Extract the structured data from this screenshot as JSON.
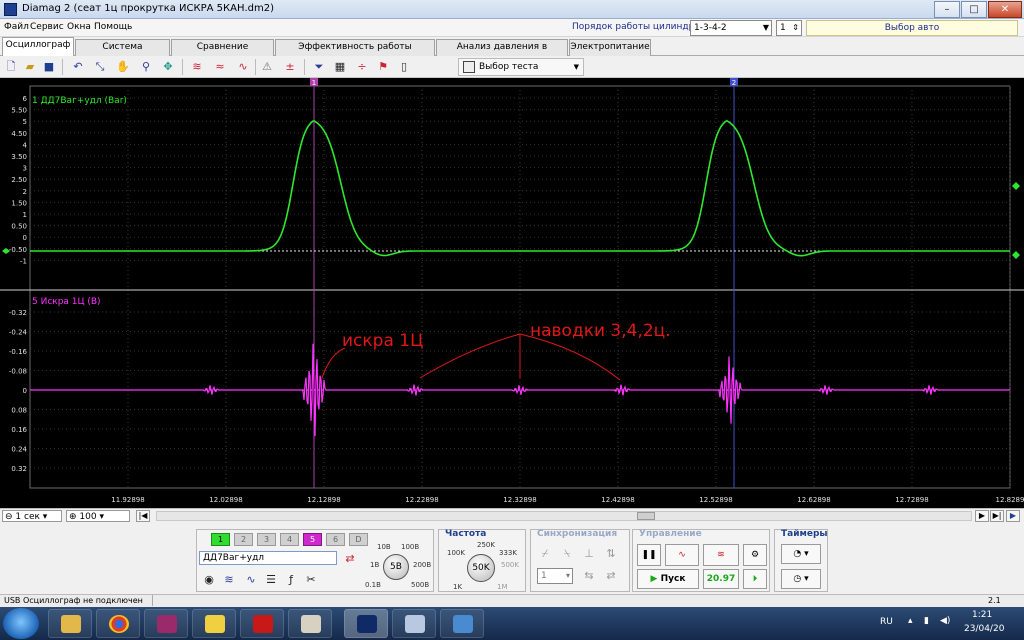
{
  "window": {
    "title": "Diamag 2 (сеат 1ц прокрутка ИСКРА 5КАН.dm2)",
    "minimize": "–",
    "maximize": "□",
    "close": "✕"
  },
  "menu": {
    "items": [
      "Файл",
      "Сервис",
      "Окна",
      "Помощь"
    ],
    "firing_order_label": "Порядок работы цилиндров",
    "firing_order_value": "1-3-4-2",
    "cylinder_value": "1",
    "auto_select": "Выбор авто"
  },
  "tabs": [
    "Осциллограф",
    "Система зажигания",
    "Сравнение цилиндров",
    "Эффективность работы цилиндров",
    "Анализ давления в цилиндре",
    "Электропитание"
  ],
  "toolbar": {
    "icons": [
      "new-file-icon",
      "open-folder-icon",
      "save-icon",
      "undo-icon",
      "autoscale-icon",
      "hand-icon",
      "zoom-icon",
      "cursor-marker-icon",
      "filter-icon",
      "wave-compare-icon",
      "fft-icon",
      "probe-icon",
      "zero-icon",
      "filter-funnel-icon",
      "grid-icon",
      "split-icon",
      "flag-icon",
      "page-icon"
    ],
    "test_select": "Выбор теста"
  },
  "scope": {
    "ch1": {
      "label": "1 ДД7Ваг+удл (Bar)",
      "color": "#2ee82e",
      "y_ticks": [
        "6",
        "5.50",
        "5",
        "4.50",
        "4",
        "3.50",
        "3",
        "2.50",
        "2",
        "1.50",
        "1",
        "0.50",
        "0",
        "-0.50",
        "-1"
      ]
    },
    "ch5": {
      "label": "5 Искра 1Ц (В)",
      "color": "#ff33ff",
      "y_ticks": [
        "-0.32",
        "-0.24",
        "-0.16",
        "-0.08",
        "0",
        "0.08",
        "0.16",
        "0.24",
        "0.32"
      ]
    },
    "x_ticks": [
      "11.92898",
      "12.02898",
      "12.12898",
      "12.22898",
      "12.32898",
      "12.42898",
      "12.52898",
      "12.62898",
      "12.72898",
      "12.8289"
    ],
    "cursor1": "1",
    "cursor2": "2",
    "annotation_spark": "искра 1Ц",
    "annotation_noise": "наводки 3,4,2ц."
  },
  "hscroll": {
    "timebase": "1 сек",
    "zoom": "100"
  },
  "channel_panel": {
    "channels": [
      "1",
      "2",
      "3",
      "4",
      "5",
      "6",
      "D"
    ],
    "channel_name": "ДД7Ваг+удл",
    "range_value": "5В",
    "range_labels": [
      "10В",
      "100В",
      "1В",
      "200В",
      "0.1В",
      "500В"
    ]
  },
  "frequency_panel": {
    "title": "Частота",
    "value": "50K",
    "labels": [
      "250K",
      "100K",
      "333K",
      "500K",
      "1K",
      "1M"
    ]
  },
  "sync_panel": {
    "title": "Синхронизация",
    "channel": "1"
  },
  "control_panel": {
    "title": "Управление",
    "start_label": "Пуск",
    "counter": "20.97"
  },
  "timers_panel": {
    "title": "Таймеры"
  },
  "status": {
    "left": "USB Осциллограф не подключен",
    "right": "2.1"
  },
  "taskbar": {
    "lang": "RU",
    "time": "1:21",
    "date": "23/04/20"
  }
}
